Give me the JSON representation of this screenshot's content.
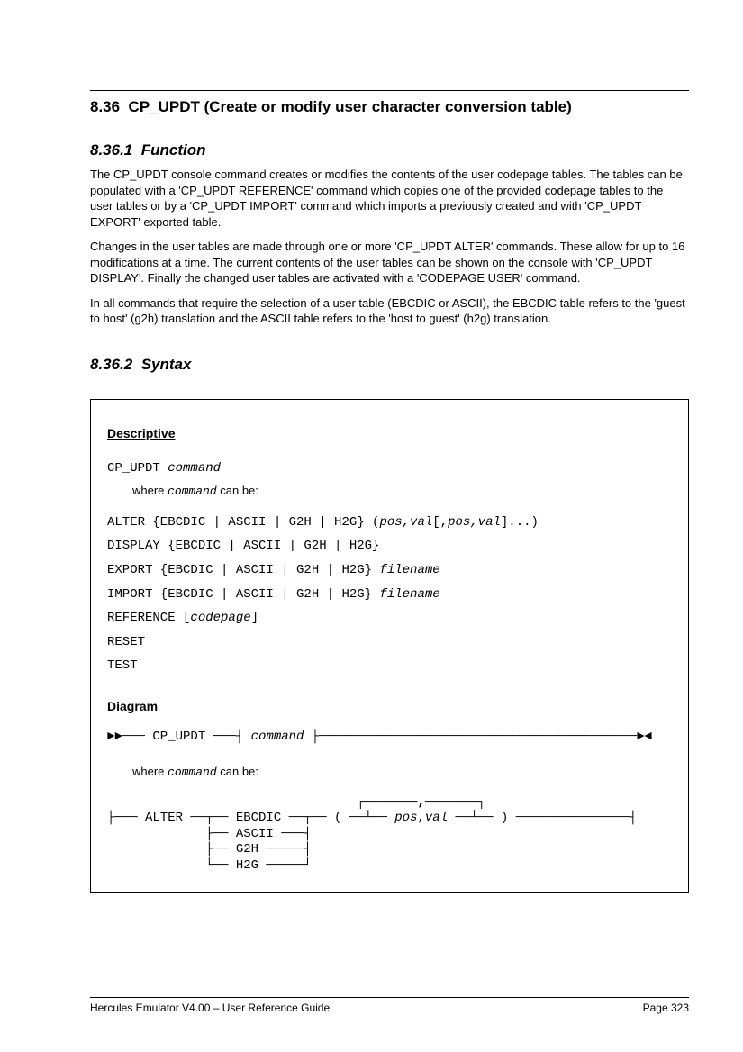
{
  "section_number": "8.36",
  "section_title": "CP_UPDT (Create or modify user character conversion table)",
  "subsection1_number": "8.36.1",
  "subsection1_title": "Function",
  "function_para1": "The CP_UPDT console command creates or modifies the contents of the user codepage tables. The tables can be populated with a 'CP_UPDT REFERENCE' command which copies one of the provided codepage tables to the user tables or by a 'CP_UPDT IMPORT' command which imports a previously created and with 'CP_UPDT EXPORT' exported table.",
  "function_para2": "Changes in the user tables are made through one or more 'CP_UPDT ALTER' commands. These allow for up to 16 modifications at a time. The current contents of the user tables can be shown on the console with 'CP_UPDT DISPLAY'. Finally the changed user tables are activated with a 'CODEPAGE USER' command.",
  "function_para3": "In all commands that require the selection of a user table (EBCDIC or ASCII), the EBCDIC table refers to the 'guest to host' (g2h) translation and the ASCII table refers to the 'host to guest' (h2g) translation.",
  "subsection2_number": "8.36.2",
  "subsection2_title": "Syntax",
  "descriptive_label": "Descriptive",
  "diagram_label": "Diagram",
  "cp_updt": "CP_UPDT",
  "command_word": "command",
  "where_text1": "where ",
  "where_text2": " can be:",
  "syntax_lines": {
    "alter_prefix": "ALTER {EBCDIC | ASCII | G2H | H2G} (",
    "alter_posval": "pos,val",
    "alter_mid": "[,",
    "alter_posval2": "pos,val",
    "alter_suffix": "]...)",
    "display": "DISPLAY {EBCDIC | ASCII | G2H | H2G}",
    "export_prefix": "EXPORT {EBCDIC | ASCII | G2H | H2G} ",
    "filename": "filename",
    "import_prefix": "IMPORT {EBCDIC | ASCII | G2H | H2G} ",
    "reference_prefix": "REFERENCE [",
    "codepage": "codepage",
    "reference_suffix": "]",
    "reset": "RESET",
    "test": "TEST"
  },
  "railroad_top": "►►─── CP_UPDT ───┤ command ├─────────────────────────────────────────────────►◄",
  "railroad_where1": "where ",
  "railroad_where2": " can be:",
  "railroad_alter": "├─── ALTER ───┬─── EBCDIC ───┬─── ( ───┬─── pos,val ───┬─── ) ───────────────┤\n              ├─── ASCII ────┤         │       ,       │\n              ├─── G2H ──────┤         └───────◄───────┘\n              └─── H2G ──────┘",
  "footer_left": "Hercules Emulator V4.00 – User Reference Guide",
  "footer_right": "Page 323"
}
